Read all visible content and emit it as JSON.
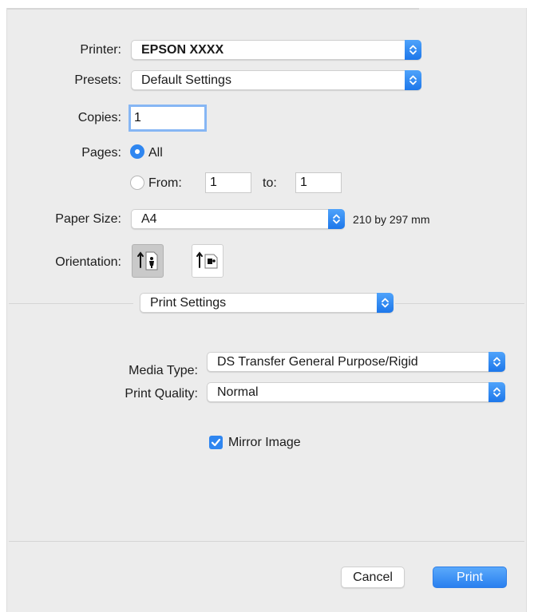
{
  "printer": {
    "label": "Printer:",
    "value": "EPSON XXXX"
  },
  "presets": {
    "label": "Presets:",
    "value": "Default Settings"
  },
  "copies": {
    "label": "Copies:",
    "value": "1"
  },
  "pages": {
    "label": "Pages:",
    "all_label": "All",
    "from_label": "From:",
    "from_value": "1",
    "to_label": "to:",
    "to_value": "1",
    "selected": "All"
  },
  "paper_size": {
    "label": "Paper Size:",
    "value": "A4",
    "dimensions": "210 by 297 mm"
  },
  "orientation": {
    "label": "Orientation:",
    "selected": "portrait",
    "options": [
      "portrait",
      "landscape"
    ]
  },
  "section_menu": {
    "value": "Print Settings"
  },
  "media_type": {
    "label": "Media Type:",
    "value": "DS Transfer General Purpose/Rigid"
  },
  "print_quality": {
    "label": "Print Quality:",
    "value": "Normal"
  },
  "mirror_image": {
    "label": "Mirror Image",
    "checked": true
  },
  "buttons": {
    "cancel": "Cancel",
    "print": "Print"
  },
  "colors": {
    "accent": "#2f86f0",
    "panel": "#ececec"
  },
  "icons": [
    "chevron-updown-icon",
    "checkmark-icon",
    "portrait-orientation-icon",
    "landscape-orientation-icon"
  ]
}
